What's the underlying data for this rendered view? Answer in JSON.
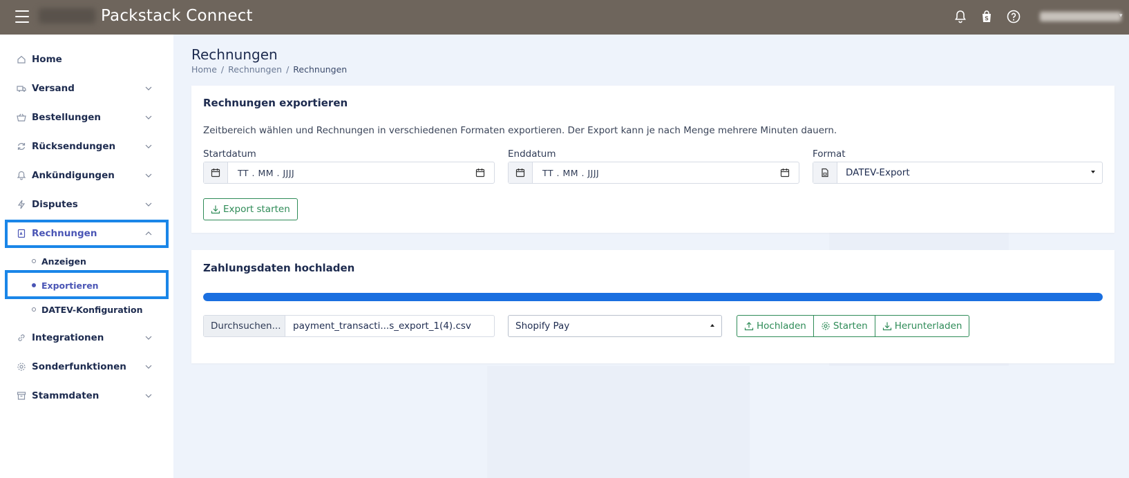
{
  "header": {
    "app_title": "Packstack Connect",
    "icons": [
      "menu-icon",
      "bell-icon",
      "shopify-icon",
      "help-icon"
    ],
    "bg_color": "#6e655c"
  },
  "sidebar": {
    "items": [
      {
        "label": "Home",
        "icon": "home-icon"
      },
      {
        "label": "Versand",
        "icon": "truck-icon"
      },
      {
        "label": "Bestellungen",
        "icon": "basket-icon"
      },
      {
        "label": "Rücksendungen",
        "icon": "return-icon"
      },
      {
        "label": "Ankündigungen",
        "icon": "bell-icon"
      },
      {
        "label": "Disputes",
        "icon": "bolt-icon"
      },
      {
        "label": "Rechnungen",
        "icon": "invoice-icon",
        "expanded": true
      },
      {
        "label": "Integrationen",
        "icon": "link-icon"
      },
      {
        "label": "Sonderfunktionen",
        "icon": "gear-icon"
      },
      {
        "label": "Stammdaten",
        "icon": "archive-icon"
      }
    ],
    "subitems": [
      {
        "label": "Anzeigen"
      },
      {
        "label": "Exportieren",
        "active": true
      },
      {
        "label": "DATEV-Konfiguration"
      }
    ],
    "highlight_color": "#1a86e8",
    "active_color": "#4a55b5"
  },
  "page": {
    "title": "Rechnungen",
    "breadcrumb": [
      "Home",
      "Rechnungen",
      "Rechnungen"
    ]
  },
  "export_card": {
    "title": "Rechnungen exportieren",
    "description": "Zeitbereich wählen und Rechnungen in verschiedenen Formaten exportieren. Der Export kann je nach Menge mehrere Minuten dauern.",
    "start_label": "Startdatum",
    "start_placeholder": "TT . MM . JJJJ",
    "end_label": "Enddatum",
    "end_placeholder": "TT . MM . JJJJ",
    "format_label": "Format",
    "format_value": "DATEV-Export",
    "export_button": "Export starten"
  },
  "upload_card": {
    "title": "Zahlungsdaten hochladen",
    "progress": 1.0,
    "browse_button": "Durchsuchen...",
    "file_name": "payment_transacti...s_export_1(4).csv",
    "provider_value": "Shopify Pay",
    "upload_button": "Hochladen",
    "start_button": "Starten",
    "download_button": "Herunterladen",
    "accent_color": "#2e8b57",
    "progress_color": "#1a6fe0"
  }
}
